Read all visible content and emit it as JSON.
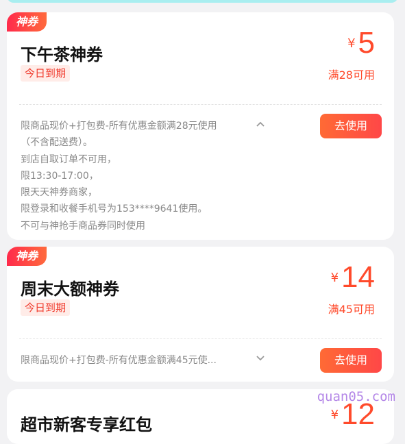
{
  "coupons": [
    {
      "tag": "神券",
      "title": "下午茶神券",
      "expiry": "今日到期",
      "currency": "¥",
      "amount": "5",
      "condition": "满28可用",
      "rules": [
        "限商品现价+打包费-所有优惠金额满28元使用",
        "（不含配送费）。",
        "到店自取订单不可用，",
        "限13:30-17:00，",
        "限天天神券商家，",
        "限登录和收餐手机号为153****9641使用。",
        "不可与神抢手商品券同时使用"
      ],
      "toggle_icon": "chevron-up-icon",
      "button": "去使用"
    },
    {
      "tag": "神券",
      "title": "周末大额神券",
      "expiry": "今日到期",
      "currency": "¥",
      "amount": "14",
      "condition": "满45可用",
      "rule_summary": "限商品现价+打包费-所有优惠金额满45元使...",
      "toggle_icon": "chevron-down-icon",
      "button": "去使用"
    },
    {
      "title": "超市新客专享红包",
      "currency": "¥",
      "amount": "12"
    }
  ],
  "watermark": "quan05.com",
  "colors": {
    "accent": "#ff4a2b",
    "tag_gradient_start": "#ff2a4b",
    "tag_gradient_end": "#ff6a3d"
  }
}
